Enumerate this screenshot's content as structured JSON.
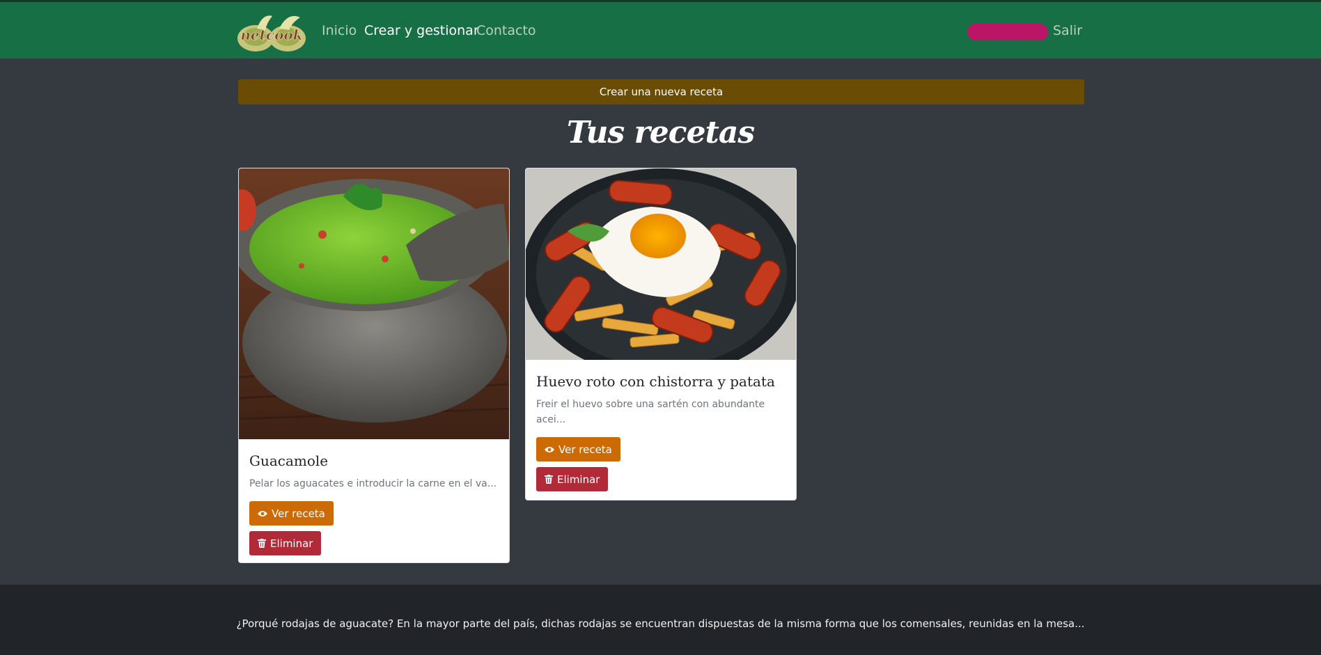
{
  "nav": {
    "brand": "netcook",
    "links": [
      "Inicio",
      "Crear y gestionar",
      "Contacto"
    ],
    "active_link": "Crear y gestionar",
    "logout": "Salir"
  },
  "main": {
    "new_recipe_button": "Crear una nueva receta",
    "title": "Tus recetas",
    "recipes": [
      {
        "title": "Guacamole",
        "description": "Pelar los aguacates e introducir la carne en el va...",
        "image": "guacamole-photo",
        "view_label": "Ver receta",
        "delete_label": "Eliminar"
      },
      {
        "title": "Huevo roto con chistorra y patata",
        "description": "Freir el huevo sobre una sartén con abundante acei...",
        "image": "huevo-roto-photo",
        "view_label": "Ver receta",
        "delete_label": "Eliminar"
      }
    ]
  },
  "footer": {
    "text": "¿Porqué rodajas de aguacate? En la mayor parte del país, dichas rodajas se encuentran dispuestas de la misma forma que los comensales, reunidas en la mesa..."
  },
  "colors": {
    "navbar": "#176f45",
    "background": "#343a40",
    "new_recipe_button": "#6a4c04",
    "view_button": "#cc6a06",
    "delete_button": "#b02a37",
    "user_pill": "#bb1565",
    "footer": "#212529"
  }
}
